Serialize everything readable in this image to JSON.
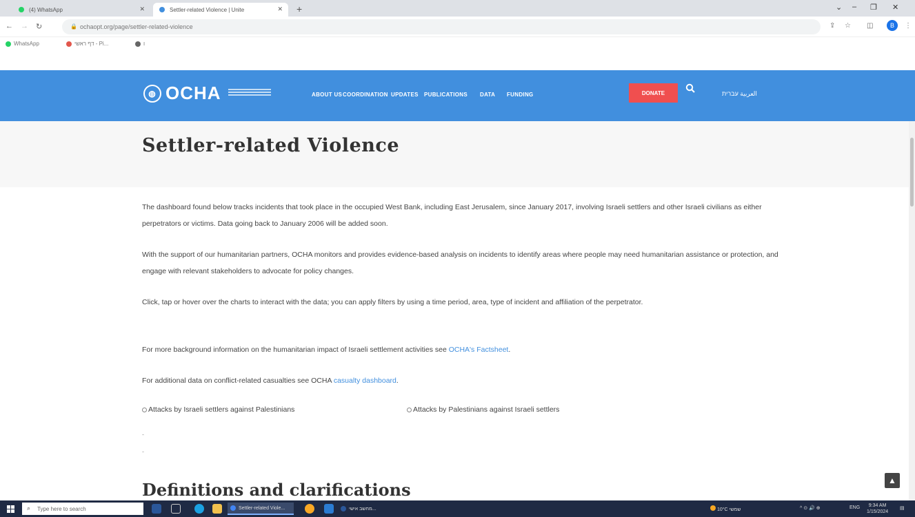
{
  "browser": {
    "tabs": [
      {
        "label": "(4) WhatsApp",
        "active": false
      },
      {
        "label": "Settler-related Violence | Unite",
        "active": true
      }
    ],
    "new_tab": "+",
    "window_controls": [
      "⌄",
      "–",
      "❐",
      "✕"
    ],
    "url": "ochaopt.org/page/settler-related-violence",
    "bookmarks": [
      {
        "label": "WhatsApp"
      },
      {
        "label": "דף ראשי - Pi..."
      },
      {
        "label": "ו"
      }
    ],
    "profile_initial": "B"
  },
  "site": {
    "logo_text": "OCHA",
    "nav": [
      "ABOUT US",
      "COORDINATION",
      "UPDATES",
      "PUBLICATIONS",
      "DATA",
      "FUNDING"
    ],
    "donate_label": "DONATE",
    "languages": "العربية עברית",
    "accent_color": "#418fde",
    "donate_color": "#f04f4f"
  },
  "page": {
    "title": "Settler-related Violence",
    "paragraphs": [
      "The dashboard found below tracks incidents that took place in the occupied West Bank, including East Jerusalem, since January 2017, involving Israeli settlers and other Israeli civilians as either perpetrators or victims. Data going back to January 2006 will be added soon.",
      "With the support of our humanitarian partners, OCHA monitors and provides evidence-based analysis on incidents to identify areas where people may need humanitarian assistance or protection, and engage with relevant stakeholders to advocate for policy changes.",
      "Click, tap or hover over the charts to interact with the data; you can apply filters by using a time period, area, type of incident and affiliation of the perpetrator."
    ],
    "factsheet_prefix": "For more background information on the humanitarian impact of Israeli settlement activities see ",
    "factsheet_link": "OCHA's Factsheet",
    "factsheet_suffix": ".",
    "casualty_prefix": "For additional data on conflict-related casualties see OCHA ",
    "casualty_link": "casualty dashboard",
    "casualty_suffix": ".",
    "radio_1": "Attacks by Israeli settlers against Palestinians",
    "radio_2": "Attacks by Palestinians against Israeli settlers",
    "bullets": [
      "-",
      "-"
    ],
    "definitions_title": "Definitions and clarifications"
  },
  "taskbar": {
    "search_placeholder": "Type here to search",
    "active_app": "Settler-related Viole...",
    "second_app": "מחשב אישי...",
    "weather": "10°C שמשי",
    "time": "9:34 AM",
    "date": "1/15/2024",
    "lang": "ENG"
  }
}
